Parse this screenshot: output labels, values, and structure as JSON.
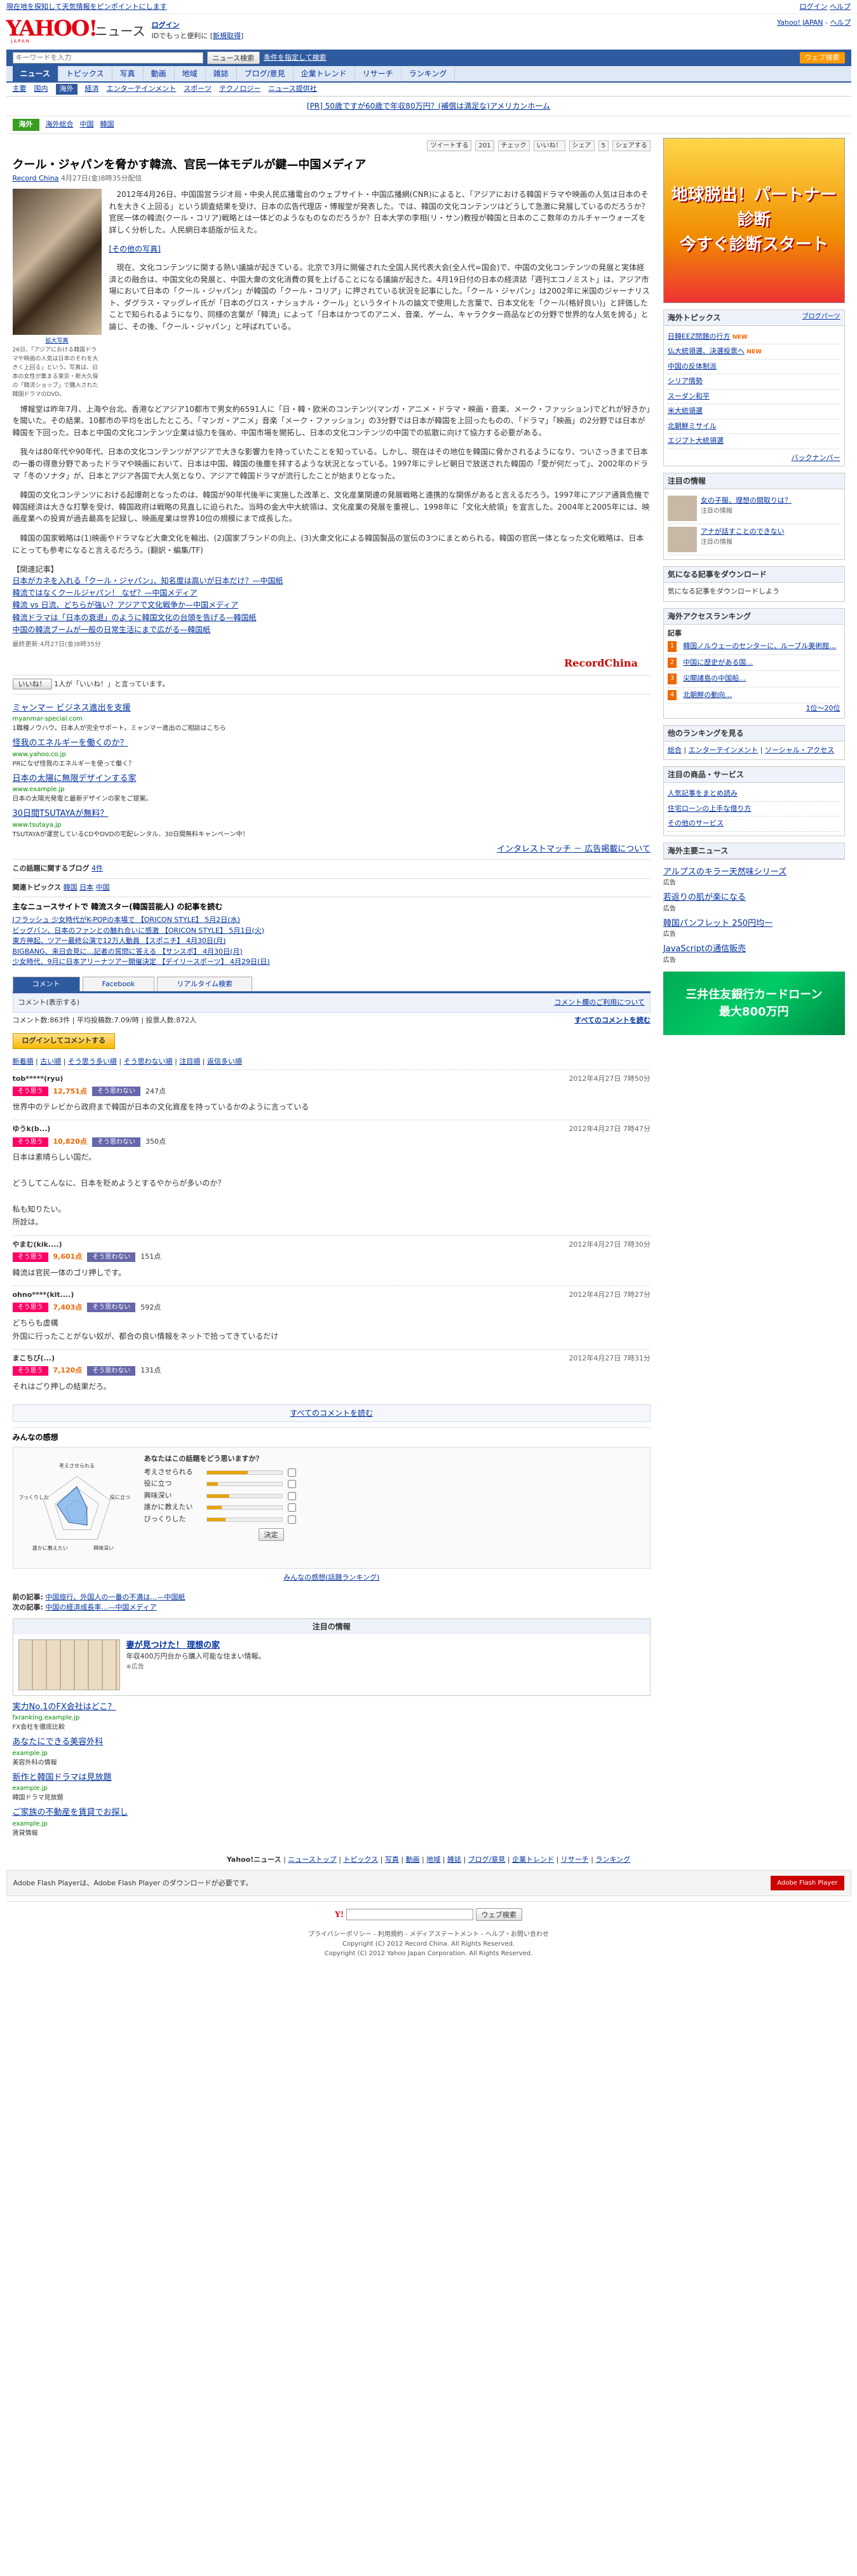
{
  "top_notice": {
    "left": "現在地を探知して天気情報をピンポイントにします",
    "right_logo": "Y!",
    "right_links": [
      "ログイン",
      "ヘルプ"
    ]
  },
  "header": {
    "logo": "YAHOO!",
    "logo_sub": "JAPAN",
    "service": "ニュース",
    "login": "ログイン",
    "login_sub": "IDでもっと便利に",
    "register": "新規取得",
    "right_links": [
      "Yahoo! JAPAN",
      "ヘルプ"
    ]
  },
  "search": {
    "placeholder": "キーワードを入力",
    "button": "ニュース検索",
    "link": "条件を指定して検索",
    "right": "ウェブ検索"
  },
  "gnav": [
    "ニュース",
    "トピックス",
    "写真",
    "動画",
    "地域",
    "雑誌",
    "ブログ/意見",
    "企業トレンド",
    "リサーチ",
    "ランキング"
  ],
  "snav": [
    "主要",
    "国内",
    "海外",
    "経済",
    "エンターテインメント",
    "スポーツ",
    "テクノロジー",
    "ニュース提供社"
  ],
  "snav_active": 3,
  "top_ad": "[PR] 50歳ですが60歳で年収80万円？(補償は満足な)アメリカンホーム",
  "category": {
    "tag": "海外",
    "links": [
      "海外総合",
      "中国",
      "韓国"
    ]
  },
  "social": {
    "tweet": "ツイートする",
    "tweet_count": "201",
    "check": "チェック",
    "like": "いいね！",
    "mixi": "シェア",
    "count": "5",
    "share": "シェアする"
  },
  "article": {
    "title": "クール・ジャパンを脅かす韓流、官民一体モデルが鍵—中国メディア",
    "source": "Record China",
    "date": "4月27日(金)8時35分配信",
    "photo_caption": "拡大写真",
    "photo_desc": "26日、「アジアにおける韓国ドラマや映画の人気は日本のそれを大きく上回る」という。写真は、日本の女性が集まる東京・新大久保の「韓流ショップ」で購入された韓国ドラマのDVD。",
    "photo_link": "[その他の写真]",
    "paragraphs": [
      "2012年4月26日、中国国営ラジオ局・中央人民広播電台のウェブサイト・中国広播網(CNR)によると、「アジアにおける韓国ドラマや映画の人気は日本のそれを大きく上回る」という調査結果を受け、日本の広告代理店・博報堂が発表した。では、韓国の文化コンテンツはどうして急激に発展しているのだろうか？官民一体の韓流(クール・コリア)戦略とは一体どのようなものなのだろうか？日本大学の李相(リ・サン)教授が韓国と日本のここ数年のカルチャーウォーズを詳しく分析した。人民網日本語版が伝えた。",
      "現在、文化コンテンツに関する熱い議論が起きている。北京で3月に開催された全国人民代表大会(全人代=国会)で、中国の文化コンテンツの発展と実体経済との融合は、中国文化の発展と、中国大衆の文化消費の質を上げることになる議論が起きた。4月19日付の日本の経済誌「週刊エコノミスト」は、アジア市場において日本の「クール・ジャパン」が韓国の「クール・コリア」に押されている状況を記事にした。「クール・ジャパン」は2002年に米国のジャーナリスト、ダグラス・マッグレイ氏が「日本のグロス・ナショナル・クール」というタイトルの論文で使用した言葉で、日本文化を「クール(格好良い)」と評価したことで知られるようになり、同様の言葉が「韓流」によって「日本はかつてのアニメ、音楽、ゲーム、キャラクター商品などの分野で世界的な人気を誇る」と論じ、その後、「クール・ジャパン」と呼ばれている。",
      "博報堂は昨年7月、上海や台北、香港などアジア10都市で男女約6591人に「日・韓・欧米のコンテンツ(マンガ・アニメ・ドラマ・映画・音楽、メーク・ファッション)でどれが好きか」を聞いた。その結果、10都市の平均を出したところ、「マンガ・アニメ」音楽「メーク・ファッション」の3分野では日本が韓国を上回ったものの、「ドラマ」「映画」の2分野では日本が韓国を下回った。日本と中国の文化コンテンツ企業は協力を強め、中国市場を開拓し、日本の文化コンテンツの中国での拡散に向けて協力する必要がある。",
      "我々は80年代や90年代、日本の文化コンテンツがアジアで大きな影響力を持っていたことを知っている。しかし、現在はその地位を韓国に脅かされるようになり、ついさっきまで日本の一番の得意分野であったドラマや映画において、日本は中国、韓国の後塵を拝するような状況となっている。1997年にテレビ朝日で放送された韓国の「愛が何だって」、2002年のドラマ「冬のソナタ」が、日本とアジア各国で大人気となり、アジアで韓国ドラマが流行したことが始まりとなった。",
      "韓国の文化コンテンツにおける起爆剤となったのは、韓国が90年代後半に実施した改革と、文化産業関連の発展戦略と連携的な関係があると言えるだろう。1997年にアジア通貨危機で韓国経済は大きな打撃を受け、韓国政府は戦略の見直しに迫られた。当時の金大中大統領は、文化産業の発展を重視し、1998年に「文化大統領」を宣言した。2004年と2005年には、映画産業への投資が過去最高を記録し、映画産業は世界10位の規模にまで成長した。",
      "韓国の国家戦略は(1)映画やドラマなど大衆文化を輸出、(2)国家ブランドの向上、(3)大衆文化による韓国製品の宣伝の3つにまとめられる。韓国の官民一体となった文化戦略は、日本にとっても参考になると言えるだろう。(翻訳・編集/TF)"
    ]
  },
  "related": {
    "title": "【関連記事】",
    "links": [
      "日本がカネを入れる「クール・ジャパン」、知名度は高いが日本だけ？—中国紙",
      "韓流ではなくクールジャパン！ なぜ？—中国メディア",
      "韓流 vs 日流、どちらが強い？アジアで文化戦争か—中国メディア",
      "韓流ドラマは「日本の衰退」のように韓国文化の台頭を告げる—韓国紙",
      "中国の韓流ブームが一般の日常生活にまで広がる—韓国紙"
    ],
    "updated": "最終更新:4月27日(金)8時35分"
  },
  "source_logo": "RecordChina",
  "fb_like": {
    "button": "いいね！",
    "text": "1人が「いいね！」と言っています。"
  },
  "ads": [
    {
      "title": "ミャンマー ビジネス進出を支援",
      "url": "myanmar-special.com",
      "desc": "1職種ノウハウ。日本人が完全サポート。ミャンマー進出のご相談はこちら"
    },
    {
      "title": "怪我のエネルギーを働くのか？",
      "url": "www.yahoo.co.jp",
      "desc": "PRになぜ怪我のエネルギーを使って働く？"
    },
    {
      "title": "日本の太陽に無限デザインする家",
      "url": "www.example.jp",
      "desc": "日本の太陽光発電と最新デザインの家をご提案。"
    },
    {
      "title": "30日間TSUTAYAが無料？",
      "url": "www.tsutaya.jp",
      "desc": "TSUTAYAが運営しているCDやDVDの宅配レンタル、30日間無料キャンペーン中！"
    }
  ],
  "ad_note": "インタレストマッチ － 広告掲載について",
  "blogs": {
    "title": "この話題に関するブログ",
    "count": "4件"
  },
  "pickup": {
    "label": "関連トピックス",
    "topics": [
      "韓国",
      "日本",
      "中国"
    ]
  },
  "sub_news": {
    "title": "主なニュースサイトで 韓流スター(韓国芸能人) の記事を読む",
    "items": [
      "Jフラッシュ 少女時代がK-POPの本場で 【ORICON STYLE】 5月2日(水)",
      "ビッグバン、日本のファンとの触れ合いに感激 【ORICON STYLE】 5月1日(火)",
      "東方神起、ツアー最終公演で12万人動員 【スポニチ】 4月30日(月)",
      "BIGBANG、来日会見に…記者の質問に答える 【サンスポ】 4月30日(月)",
      "少女時代、9月に日本アリーナツアー開催決定 【デイリースポーツ】 4月29日(日)"
    ]
  },
  "tabs": [
    "コメント",
    "Facebook",
    "リアルタイム検索"
  ],
  "comments_meta": {
    "label": "コメント(表示する)",
    "count_info": "コメント数:863件",
    "avg": "平均投稿数:7.09/時",
    "votes": "投票人数:872人",
    "all_link": "すべてのコメントを読む",
    "login_btn": "ログインしてコメントする",
    "sort": [
      "新着順",
      "古い順",
      "そう思う多い順",
      "そう思わない順",
      "注目順",
      "返信多い順"
    ]
  },
  "comments": [
    {
      "user": "tob*****(ryu)",
      "date": "2012年4月27日 7時50分",
      "agree": "12,751点",
      "disagree": "247点",
      "body": "世界中のテレビから政府まで韓国が日本の文化資産を持っているかのように言っている"
    },
    {
      "user": "ゆうk(b...)",
      "date": "2012年4月27日 7時47分",
      "agree": "10,820点",
      "disagree": "350点",
      "body": "日本は素晴らしい国だ。\n\nどうしてこんなに、日本を貶めようとするやからが多いのか？\n\n私も知りたい。\n所詮は。"
    },
    {
      "user": "やまむ(kik....)",
      "date": "2012年4月27日 7時30分",
      "agree": "9,601点",
      "disagree": "151点",
      "body": "韓流は官民一体のゴリ押しです。"
    },
    {
      "user": "ohno****(kit....)",
      "date": "2012年4月27日 7時27分",
      "agree": "7,403点",
      "disagree": "592点",
      "body": "どちらも虚構\n外国に行ったことがない奴が、都合の良い情報をネットで拾ってきているだけ"
    },
    {
      "user": "まこちび(...)",
      "date": "2012年4月27日 7時31分",
      "agree": "7,120点",
      "disagree": "131点",
      "body": "それはごり押しの結果だろ。"
    }
  ],
  "more_comments": "すべてのコメントを読む",
  "comment_policy": "コメント欄のご利用について",
  "radar": {
    "title": "みんなの感想",
    "question": "あなたはこの話題をどう思いますか？",
    "axes": [
      "考えさせられる",
      "役に立つ",
      "興味深い",
      "誰かに教えたい",
      "びっくりした"
    ],
    "values": [
      0.7,
      0.3,
      0.5,
      0.4,
      0.6
    ],
    "rows": [
      {
        "label": "考えさせられる",
        "v": 0.55
      },
      {
        "label": "役に立つ",
        "v": 0.15
      },
      {
        "label": "興味深い",
        "v": 0.3
      },
      {
        "label": "誰かに教えたい",
        "v": 0.2
      },
      {
        "label": "びっくりした",
        "v": 0.25
      }
    ],
    "decide": "決定",
    "ranking": "みんなの感想(話題ランキング)"
  },
  "prevnext": {
    "prev_label": "前の記事:",
    "prev": "中国旅行、外国人の一番の不満は…—中国紙",
    "next_label": "次の記事:",
    "next": "中国の経済成長率…—中国メディア"
  },
  "notice": {
    "header": "注目の情報",
    "title": "妻が見つけた！ 理想の家",
    "desc": "年収400万円台から購入可能な住まい情報。",
    "note": "※広告"
  },
  "bottom_ads": [
    {
      "title": "実力No.1のFX会社はどこ？",
      "url": "fxranking.example.jp",
      "desc": "FX会社を徹底比較"
    },
    {
      "title": "あなたにできる美容外科",
      "url": "example.jp",
      "desc": "美容外科の情報"
    },
    {
      "title": "新作と韓国ドラマは見放題",
      "url": "example.jp",
      "desc": "韓国ドラマ見放題"
    },
    {
      "title": "ご家族の不動産を賃貸でお探し",
      "url": "example.jp",
      "desc": "賃貸情報"
    }
  ],
  "footer_links": [
    "Yahoo!ニュース",
    "ニューストップ",
    "トピックス",
    "写真",
    "動画",
    "地域",
    "雑誌",
    "ブログ/意見",
    "企業トレンド",
    "リサーチ",
    "ランキング"
  ],
  "flash": {
    "text": "Adobe Flash Playerは、Adobe Flash Player のダウンロードが必要です。",
    "badge": "Adobe Flash Player"
  },
  "fsearch": {
    "button": "ウェブ検索"
  },
  "copyright": [
    "プライバシーポリシー - 利用規約 - メディアステートメント - ヘルプ・お問い合わせ",
    "Copyright (C) 2012 Record China. All Rights Reserved.",
    "Copyright (C) 2012 Yahoo Japan Corporation. All Rights Reserved."
  ],
  "sidebar": {
    "pr_ad": "地球脱出！パートナー診断\n今すぐ診断スタート",
    "topics": {
      "title": "海外トピックス",
      "more": "ブログパーツ",
      "items": [
        "日韓EEZ問題の行方",
        "仏大統領選、決選投票へ",
        "中国の反体制派",
        "シリア情勢",
        "スーダン和平",
        "米大統領選",
        "北朝鮮ミサイル",
        "エジプト大統領選"
      ]
    },
    "backnumber": "バックナンバー",
    "attention": {
      "title": "注目の情報",
      "items": [
        {
          "title": "女の子服、理想の間取りは？",
          "desc": "注目の情報"
        },
        {
          "title": "アナが話すことのできない",
          "desc": "注目の情報"
        }
      ]
    },
    "recommend": {
      "title": "気になる記事をダウンロード",
      "desc": "気になる記事をダウンロードしよう"
    },
    "access": {
      "title": "海外アクセスランキング",
      "sub": "記事",
      "items": [
        "韓国ノルウェーのセンターに、ルーブル美術館…",
        "中国に歴史がある国…",
        "尖閣諸島の中国船…",
        "北朝鮮の動向…"
      ],
      "more": "1位〜20位"
    },
    "ranking_list": {
      "title": "他のランキングを見る",
      "items": [
        "総合",
        "エンターテインメント",
        "ソーシャル・アクセス"
      ]
    },
    "product": {
      "title": "注目の商品・サービス",
      "items": [
        "人気記事をまとめ読み",
        "住宅ローンの上手な借り方",
        "その他のサービス"
      ]
    },
    "sponsor": {
      "title": "海外主要ニュース"
    },
    "ads_side": [
      {
        "title": "アルプスのキラー天然味シリーズ",
        "desc": "広告"
      },
      {
        "title": "若返りの肌が楽になる",
        "desc": "広告"
      },
      {
        "title": "韓国パンフレット 250円均一",
        "desc": "広告"
      },
      {
        "title": "JavaScriptの通信販売",
        "desc": "広告"
      }
    ],
    "card_ad": "三井住友銀行カードローン\n最大800万円"
  }
}
